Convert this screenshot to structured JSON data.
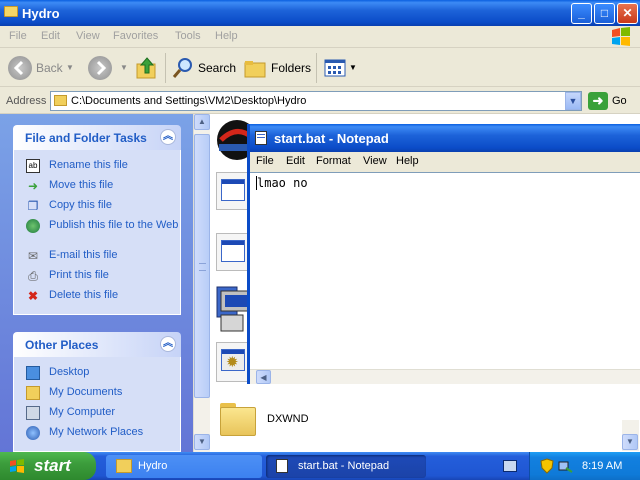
{
  "explorer": {
    "title": "Hydro",
    "menu": [
      "File",
      "Edit",
      "View",
      "Favorites",
      "Tools",
      "Help"
    ],
    "toolbar": {
      "back": "Back",
      "search": "Search",
      "folders": "Folders"
    },
    "address": {
      "label": "Address",
      "value": "C:\\Documents and Settings\\VM2\\Desktop\\Hydro",
      "go": "Go"
    },
    "file_tasks": {
      "title": "File and Folder Tasks",
      "items": [
        "Rename this file",
        "Move this file",
        "Copy this file",
        "Publish this file to the Web",
        "E-mail this file",
        "Print this file",
        "Delete this file"
      ]
    },
    "other_places": {
      "title": "Other Places",
      "items": [
        "Desktop",
        "My Documents",
        "My Computer",
        "My Network Places"
      ]
    },
    "files": [
      {
        "name": "DXWND"
      }
    ]
  },
  "notepad": {
    "title": "start.bat - Notepad",
    "menu": [
      "File",
      "Edit",
      "Format",
      "View",
      "Help"
    ],
    "content": "lmao no"
  },
  "taskbar": {
    "start": "start",
    "buttons": [
      "Hydro",
      "start.bat - Notepad"
    ],
    "clock": "8:19 AM"
  },
  "colors": {
    "title_blue": "#0b4cc8",
    "link_blue": "#215dc6",
    "start_green": "#3c9d3c"
  }
}
